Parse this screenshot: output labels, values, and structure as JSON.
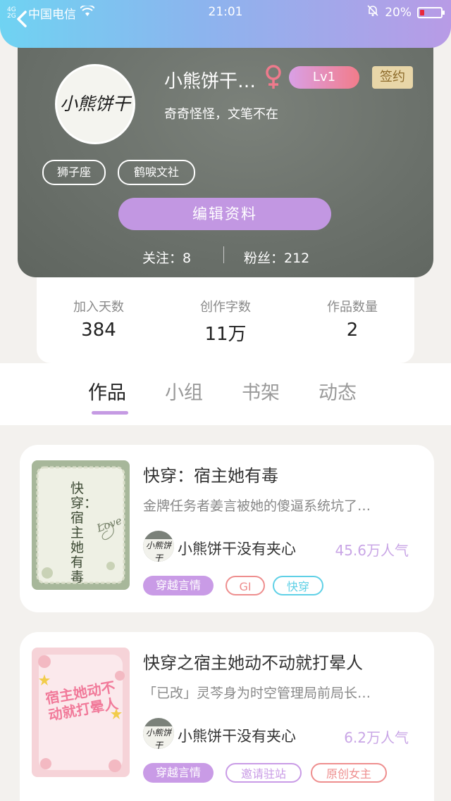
{
  "status_bar": {
    "network": "4G 2G",
    "carrier": "中国电信",
    "time": "21:01",
    "battery": "20%",
    "battery_level": 0.2
  },
  "profile": {
    "avatar_text": "小熊饼干",
    "name": "小熊饼干…",
    "level": "Lv1",
    "sign_badge": "签约",
    "bio": "奇奇怪怪，文笔不在",
    "tags": [
      "狮子座",
      "鹤唳文社"
    ],
    "edit_button": "编辑资料",
    "following": "关注：8",
    "followers": "粉丝：212"
  },
  "stats": [
    {
      "label": "加入天数",
      "value": "384"
    },
    {
      "label": "创作字数",
      "value": "11万"
    },
    {
      "label": "作品数量",
      "value": "2"
    }
  ],
  "tabs": [
    "作品",
    "小组",
    "书架",
    "动态"
  ],
  "active_tab": "作品",
  "books": [
    {
      "title": "快穿：宿主她有毒",
      "desc": "金牌任务者姜言被她的傻逼系统坑了…",
      "author": "小熊饼干没有夹心",
      "author_avatar_text": "小熊饼干",
      "popularity": "45.6万人气",
      "cover_text": "快穿：宿主她有毒",
      "cover_script": "Love",
      "tags": [
        {
          "label": "穿越言情",
          "style": "filled",
          "color": "#c99be6"
        },
        {
          "label": "GI",
          "style": "outline",
          "color": "#ee8e8e"
        },
        {
          "label": "快穿",
          "style": "outline",
          "color": "#5fd0e6"
        }
      ]
    },
    {
      "title": "快穿之宿主她动不动就打晕人",
      "desc": "「已改」灵芩身为时空管理局前局长…",
      "author": "小熊饼干没有夹心",
      "author_avatar_text": "小熊饼干",
      "popularity": "6.2万人气",
      "cover_text": "宿主她动不动就打晕人",
      "tags": [
        {
          "label": "穿越言情",
          "style": "filled",
          "color": "#c99be6"
        },
        {
          "label": "邀请驻站",
          "style": "outline",
          "color": "#c99be6"
        },
        {
          "label": "原创女主",
          "style": "outline",
          "color": "#ee8e8e"
        }
      ]
    }
  ],
  "colors": {
    "header_gradient_start": "#6fd3f2",
    "header_gradient_end": "#b89be6",
    "accent_purple": "#c297e2",
    "popularity_purple": "#c9a6e6"
  }
}
